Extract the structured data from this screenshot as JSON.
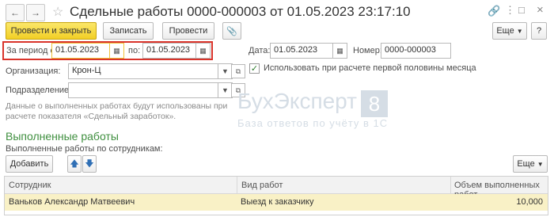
{
  "window": {
    "title": "Сдельные работы 0000-000003 от 01.05.2023 23:17:10"
  },
  "toolbar": {
    "post_close_label": "Провести и закрыть",
    "save_label": "Записать",
    "post_label": "Провести",
    "more_label": "Еще"
  },
  "period": {
    "from_label": "За период с:",
    "from_value": "01.05.2023",
    "to_label": "по:",
    "to_value": "01.05.2023"
  },
  "date": {
    "label": "Дата:",
    "value": "01.05.2023"
  },
  "number": {
    "label": "Номер:",
    "value": "0000-000003"
  },
  "organization": {
    "label": "Организация:",
    "value": "Крон-Ц"
  },
  "department": {
    "label": "Подразделение:",
    "value": ""
  },
  "use_first_half": {
    "label": "Использовать при расчете первой половины месяца",
    "checked": true
  },
  "info_text": "Данные о выполненных работах будут использованы при расчете показателя «Сдельный заработок».",
  "watermark": {
    "main": "БухЭксперт",
    "number": "8",
    "sub": "База ответов по учёту в 1С"
  },
  "works": {
    "section_title": "Выполненные работы",
    "subtitle": "Выполненные работы по сотрудникам:",
    "add_label": "Добавить",
    "more_label": "Еще",
    "columns": [
      "Сотрудник",
      "Вид работ",
      "Объем выполненных работ"
    ],
    "rows": [
      {
        "employee": "Ваньков Александр Матвеевич",
        "work_type": "Выезд к заказчику",
        "volume": "10,000"
      }
    ]
  }
}
